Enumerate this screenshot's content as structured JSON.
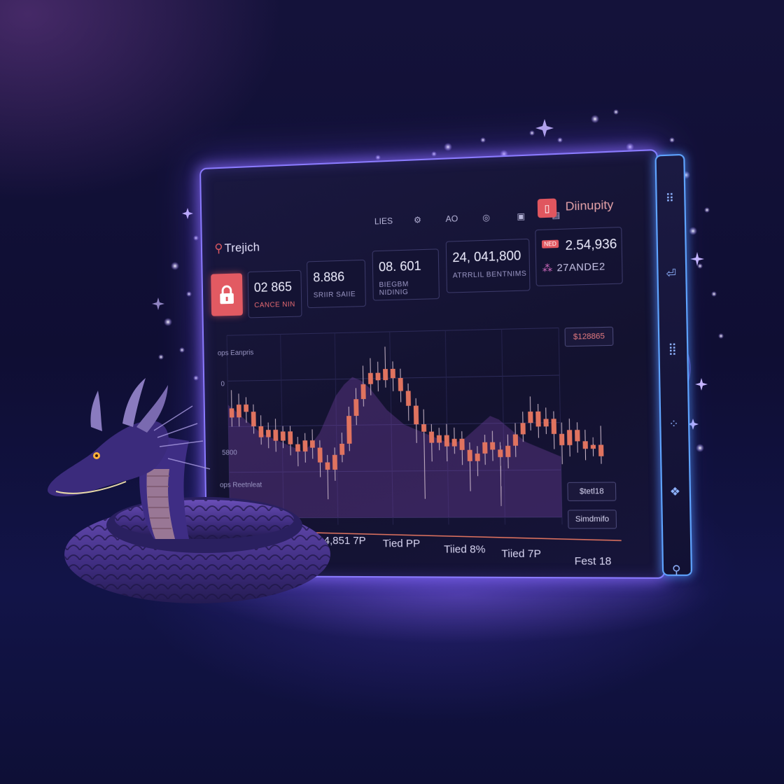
{
  "colors": {
    "accent": "#8b7bff",
    "candle": "#e0735f",
    "badge": "#e0565f",
    "rail": "#5fa4ff"
  },
  "dashboard": {
    "brand": "Trejich",
    "toolbar": [
      "LIES",
      "AO"
    ],
    "profile_badge_icon": "user-badge-icon",
    "profile_name": "Diinupity",
    "cards": [
      {
        "value": "02 865",
        "label": "CANCE NIN"
      },
      {
        "value": "8.886",
        "label": "SRIIR SAIIE"
      },
      {
        "value": "08. 601",
        "label": "BIEGBM NIDINIG"
      },
      {
        "value": "24, 041,800",
        "label": "ATRRLIL BENTNIMS"
      },
      {
        "value": "2.54,936",
        "label": "27ANDE2",
        "badge": "NED"
      }
    ],
    "chart_labels": {
      "series_label": "ops Eanpris",
      "y_top": "0",
      "y_mid": "5800",
      "lower_label": "ops Reetnleat",
      "pill_top": "$128865",
      "pill_mid": "$tetl18",
      "pill_bottom": "Simdmifo"
    },
    "x_labels": [
      "4,851 7P",
      "Tied PP",
      "Tiied 8%",
      "Tiied 7P",
      "Fest 18"
    ]
  },
  "chart_data": {
    "type": "candlestick",
    "candles": [
      [
        60,
        55,
        70,
        50
      ],
      [
        55,
        62,
        68,
        50
      ],
      [
        62,
        58,
        66,
        52
      ],
      [
        58,
        50,
        62,
        46
      ],
      [
        50,
        44,
        56,
        40
      ],
      [
        44,
        48,
        52,
        38
      ],
      [
        48,
        42,
        54,
        36
      ],
      [
        42,
        47,
        50,
        38
      ],
      [
        47,
        40,
        50,
        34
      ],
      [
        40,
        36,
        44,
        28
      ],
      [
        36,
        42,
        46,
        30
      ],
      [
        42,
        38,
        48,
        32
      ],
      [
        38,
        30,
        42,
        22
      ],
      [
        30,
        26,
        34,
        10
      ],
      [
        26,
        34,
        38,
        20
      ],
      [
        34,
        40,
        46,
        30
      ],
      [
        40,
        55,
        60,
        36
      ],
      [
        55,
        64,
        70,
        50
      ],
      [
        64,
        72,
        82,
        60
      ],
      [
        72,
        78,
        86,
        66
      ],
      [
        78,
        74,
        84,
        68
      ],
      [
        74,
        80,
        92,
        70
      ],
      [
        80,
        75,
        84,
        68
      ],
      [
        75,
        68,
        80,
        62
      ],
      [
        68,
        60,
        72,
        52
      ],
      [
        60,
        50,
        64,
        40
      ],
      [
        50,
        46,
        58,
        10
      ],
      [
        46,
        40,
        50,
        30
      ],
      [
        40,
        44,
        48,
        36
      ],
      [
        44,
        38,
        50,
        30
      ],
      [
        38,
        42,
        48,
        34
      ],
      [
        42,
        36,
        46,
        28
      ],
      [
        36,
        30,
        40,
        14
      ],
      [
        30,
        34,
        38,
        22
      ],
      [
        34,
        40,
        44,
        28
      ],
      [
        40,
        36,
        46,
        30
      ],
      [
        36,
        32,
        40,
        6
      ],
      [
        32,
        38,
        44,
        26
      ],
      [
        38,
        44,
        50,
        32
      ],
      [
        44,
        50,
        56,
        40
      ],
      [
        50,
        56,
        64,
        46
      ],
      [
        56,
        48,
        60,
        42
      ],
      [
        48,
        52,
        58,
        44
      ],
      [
        52,
        44,
        56,
        36
      ],
      [
        44,
        38,
        50,
        28
      ],
      [
        38,
        46,
        52,
        32
      ],
      [
        46,
        40,
        50,
        34
      ],
      [
        40,
        36,
        46,
        30
      ],
      [
        36,
        38,
        42,
        32
      ],
      [
        38,
        32,
        48,
        28
      ]
    ],
    "area": [
      62,
      58,
      54,
      50,
      46,
      44,
      42,
      40,
      38,
      36,
      40,
      46,
      56,
      66,
      72,
      76,
      74,
      70,
      64,
      58,
      54,
      50,
      48,
      46,
      44,
      42,
      40,
      40,
      42,
      46,
      50,
      54,
      52,
      48,
      44,
      40,
      38,
      36,
      34,
      32
    ],
    "ylim": [
      0,
      100
    ]
  }
}
